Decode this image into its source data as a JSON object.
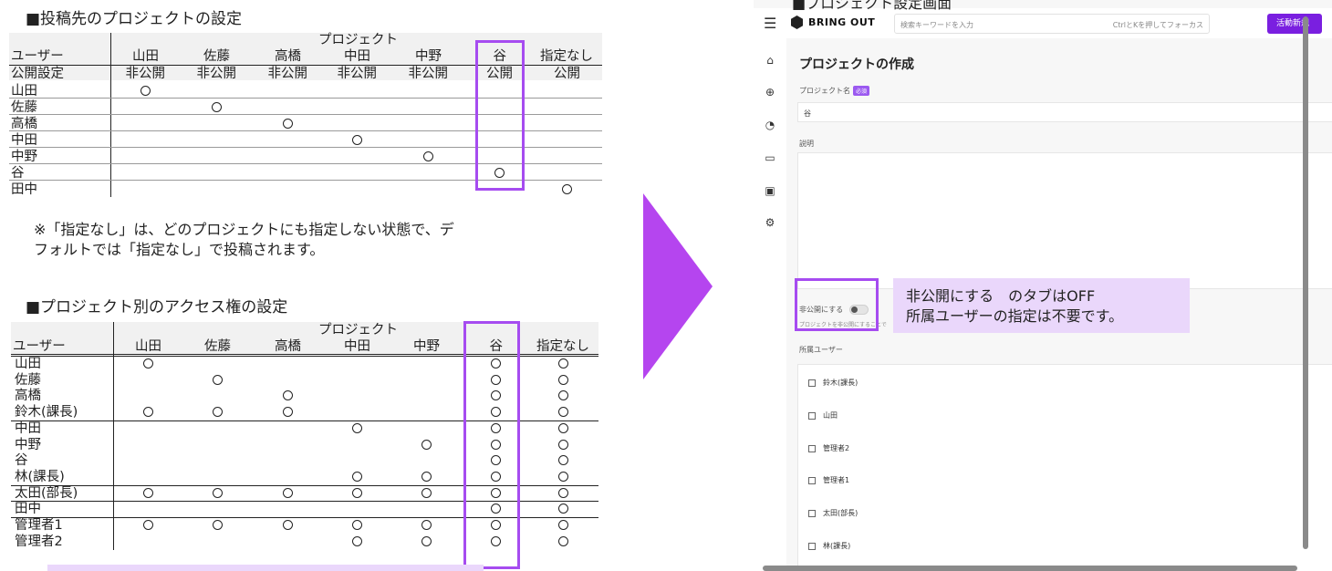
{
  "section1": {
    "title": "■投稿先のプロジェクトの設定",
    "project_header": "プロジェクト",
    "user_header": "ユーザー",
    "columns": [
      "山田",
      "佐藤",
      "高橋",
      "中田",
      "中野",
      "谷",
      "指定なし"
    ],
    "visibility_label": "公開設定",
    "visibility": [
      "非公開",
      "非公開",
      "非公開",
      "非公開",
      "非公開",
      "公開",
      "公開"
    ],
    "rows": [
      "山田",
      "佐藤",
      "高橋",
      "中田",
      "中野",
      "谷",
      "田中"
    ],
    "marks": [
      [
        0
      ],
      [
        1
      ],
      [
        2
      ],
      [
        3
      ],
      [
        4
      ],
      [
        5
      ],
      [
        6
      ]
    ]
  },
  "note": {
    "line1": "※「指定なし」は、どのプロジェクトにも指定しない状態で、デ",
    "line2": "フォルトでは「指定なし」で投稿されます。"
  },
  "section2": {
    "title": "■プロジェクト別のアクセス権の設定",
    "project_header": "プロジェクト",
    "user_header": "ユーザー",
    "columns": [
      "山田",
      "佐藤",
      "高橋",
      "中田",
      "中野",
      "谷",
      "指定なし"
    ],
    "rows": [
      "山田",
      "佐藤",
      "高橋",
      "鈴木(課長)",
      "中田",
      "中野",
      "谷",
      "林(課長)",
      "太田(部長)",
      "田中",
      "管理者1",
      "管理者2"
    ],
    "marks": [
      [
        0,
        5,
        6
      ],
      [
        1,
        5,
        6
      ],
      [
        2,
        5,
        6
      ],
      [
        0,
        1,
        2,
        5,
        6
      ],
      [
        3,
        5,
        6
      ],
      [
        4,
        5,
        6
      ],
      [
        5,
        6
      ],
      [
        3,
        4,
        5,
        6
      ],
      [
        0,
        1,
        2,
        3,
        4,
        5,
        6
      ],
      [
        5,
        6
      ],
      [
        0,
        1,
        2,
        3,
        4,
        5,
        6
      ],
      [
        3,
        4,
        5,
        6
      ]
    ]
  },
  "app": {
    "cut_title": "■プロジェクト設定画面",
    "logo": "BRING OUT",
    "search_placeholder": "検索キーワードを入力",
    "search_hint": "CtrlとKを押してフォーカス",
    "action_button": "活動新規",
    "page_title": "プロジェクトの作成",
    "name_label": "プロジェクト名",
    "required": "必須",
    "name_value": "谷",
    "desc_label": "説明",
    "private_label": "非公開にする",
    "private_help": "プロジェクトを非公開にすることで",
    "members_label": "所属ユーザー",
    "members": [
      "鈴木(課長)",
      "山田",
      "管理者2",
      "管理者1",
      "太田(部長)",
      "林(課長)"
    ]
  },
  "annotation": {
    "line1": "非公開にする　のタブはOFF",
    "line2": "所属ユーザーの指定は不要です。"
  },
  "colors": {
    "accent": "#a64cf0",
    "arrow": "#b545ef",
    "annotation_bg": "#ead7fb",
    "button": "#7a1fe0"
  }
}
